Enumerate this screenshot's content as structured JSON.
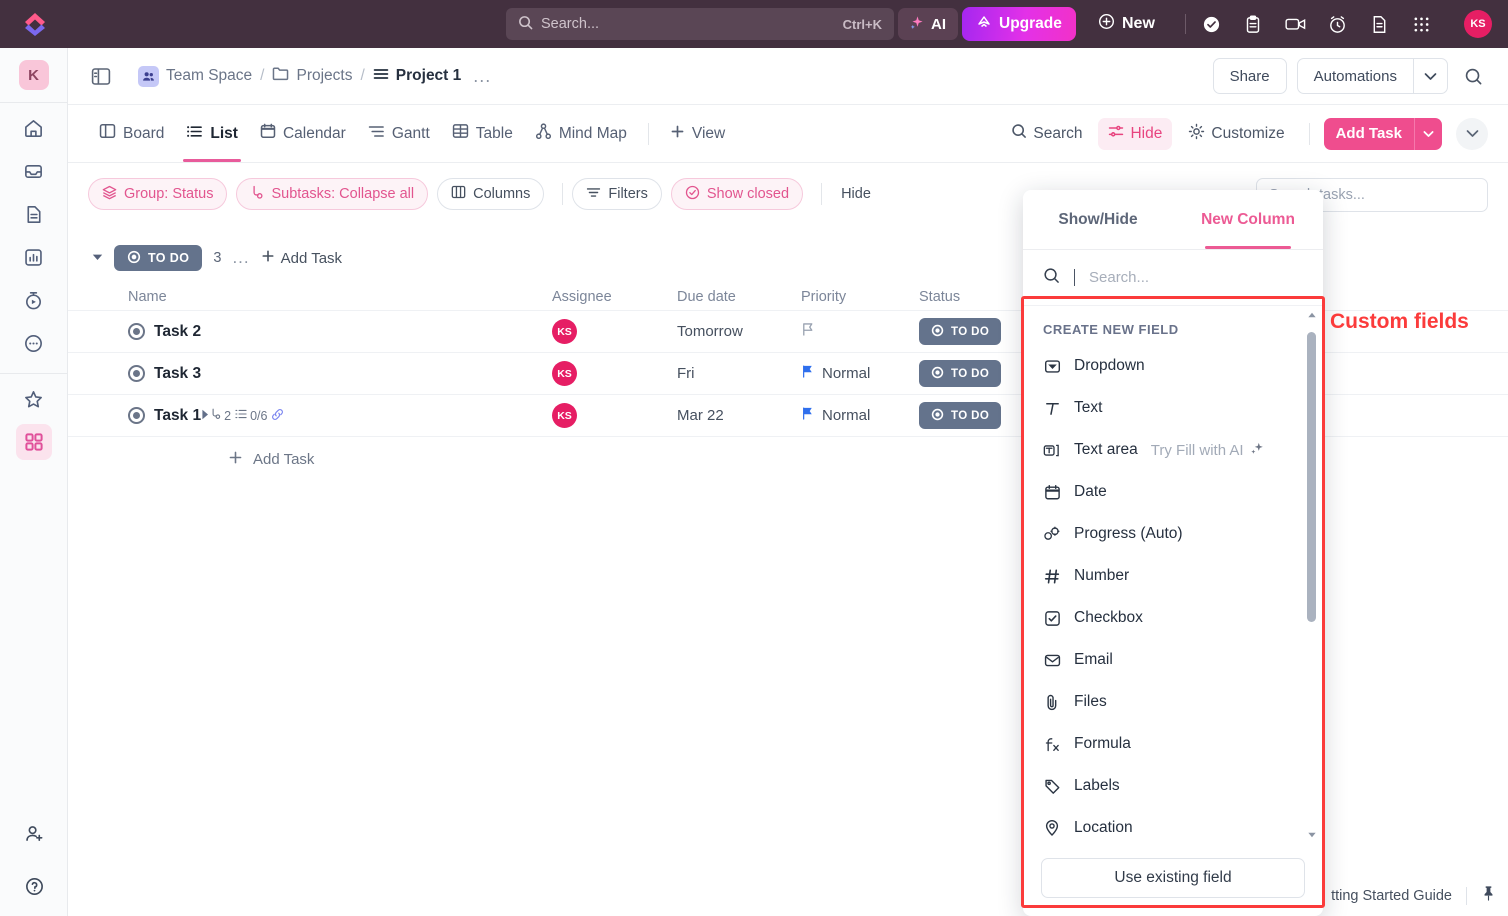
{
  "topbar": {
    "logo": "clickup-logo",
    "search": {
      "placeholder": "Search...",
      "shortcut": "Ctrl+K"
    },
    "ai_label": "AI",
    "upgrade_label": "Upgrade",
    "new_label": "New",
    "icons": [
      "check-circle-icon",
      "clipboard-icon",
      "video-camera-icon",
      "alarm-clock-icon",
      "document-icon",
      "apps-grid-icon"
    ],
    "avatar_initials": "KS"
  },
  "rail": {
    "workspace_initial": "K",
    "items": [
      "home-icon",
      "inbox-icon",
      "docs-icon",
      "dashboard-icon",
      "clips-icon",
      "more-icon"
    ],
    "pinned": [
      "star-icon",
      "apps-icon"
    ],
    "bottom": [
      "invite-user-icon",
      "help-icon"
    ]
  },
  "breadcrumb": {
    "panel_toggle": "panel-toggle-icon",
    "items": [
      {
        "label": "Team Space",
        "icon": "people-icon"
      },
      {
        "label": "Projects",
        "icon": "folder-icon"
      },
      {
        "label": "Project 1",
        "icon": "list-icon"
      }
    ],
    "separator": "/",
    "more": "...",
    "share_label": "Share",
    "automations_label": "Automations",
    "search_icon": "search-icon"
  },
  "viewbar": {
    "tabs": [
      {
        "label": "Board",
        "icon": "board-icon",
        "active": false
      },
      {
        "label": "List",
        "icon": "list-icon",
        "active": true
      },
      {
        "label": "Calendar",
        "icon": "calendar-icon",
        "active": false
      },
      {
        "label": "Gantt",
        "icon": "gantt-icon",
        "active": false
      },
      {
        "label": "Table",
        "icon": "table-icon",
        "active": false
      },
      {
        "label": "Mind Map",
        "icon": "mindmap-icon",
        "active": false
      }
    ],
    "add_view_label": "View",
    "search_label": "Search",
    "hide_label": "Hide",
    "customize_label": "Customize",
    "add_task_label": "Add Task"
  },
  "filterbar": {
    "chips": [
      {
        "label": "Group: Status",
        "icon": "layers-icon",
        "style": "pink"
      },
      {
        "label": "Subtasks: Collapse all",
        "icon": "subtask-icon",
        "style": "pink"
      },
      {
        "label": "Columns",
        "icon": "columns-icon",
        "style": "grey"
      }
    ],
    "chips2": [
      {
        "label": "Filters",
        "icon": "filter-icon",
        "style": "grey"
      },
      {
        "label": "Show closed",
        "icon": "check-circle-icon",
        "style": "pink"
      }
    ],
    "hide_label": "Hide",
    "task_search_placeholder": "Search tasks..."
  },
  "group": {
    "status_label": "TO DO",
    "count": "3",
    "more": "...",
    "add_task_label": "Add Task"
  },
  "table": {
    "headers": [
      "Name",
      "Assignee",
      "Due date",
      "Priority",
      "Status"
    ],
    "rows": [
      {
        "name": "Task 2",
        "assignee": "KS",
        "due": "Tomorrow",
        "priority": "",
        "priority_flag": "empty",
        "status": "TO DO",
        "expandable": false,
        "meta": []
      },
      {
        "name": "Task 3",
        "assignee": "KS",
        "due": "Fri",
        "priority": "Normal",
        "priority_flag": "blue",
        "status": "TO DO",
        "expandable": false,
        "meta": []
      },
      {
        "name": "Task 1",
        "assignee": "KS",
        "due": "Mar 22",
        "priority": "Normal",
        "priority_flag": "blue",
        "status": "TO DO",
        "expandable": true,
        "meta": [
          {
            "icon": "subtask-icon",
            "value": "2"
          },
          {
            "icon": "checklist-icon",
            "value": "0/6"
          },
          {
            "icon": "link-icon",
            "value": ""
          }
        ]
      }
    ],
    "add_task_label": "Add Task"
  },
  "popup": {
    "tabs": [
      {
        "label": "Show/Hide",
        "active": false
      },
      {
        "label": "New Column",
        "active": true
      }
    ],
    "search_placeholder": "Search...",
    "section_title": "CREATE NEW FIELD",
    "fields": [
      {
        "label": "Dropdown",
        "icon": "dropdown-icon",
        "hint": ""
      },
      {
        "label": "Text",
        "icon": "text-icon",
        "hint": ""
      },
      {
        "label": "Text area",
        "icon": "textarea-icon",
        "hint": "Try Fill with AI"
      },
      {
        "label": "Date",
        "icon": "calendar-icon",
        "hint": ""
      },
      {
        "label": "Progress (Auto)",
        "icon": "progress-icon",
        "hint": ""
      },
      {
        "label": "Number",
        "icon": "number-icon",
        "hint": ""
      },
      {
        "label": "Checkbox",
        "icon": "checkbox-icon",
        "hint": ""
      },
      {
        "label": "Email",
        "icon": "email-icon",
        "hint": ""
      },
      {
        "label": "Files",
        "icon": "files-icon",
        "hint": ""
      },
      {
        "label": "Formula",
        "icon": "formula-icon",
        "hint": ""
      },
      {
        "label": "Labels",
        "icon": "labels-icon",
        "hint": ""
      },
      {
        "label": "Location",
        "icon": "location-icon",
        "hint": ""
      }
    ],
    "use_existing_label": "Use existing field"
  },
  "annotation": {
    "label": "Custom fields",
    "color": "#fb3b3b"
  },
  "footer": {
    "guide_label": "tting Started Guide",
    "pin_icon": "pin-icon"
  }
}
